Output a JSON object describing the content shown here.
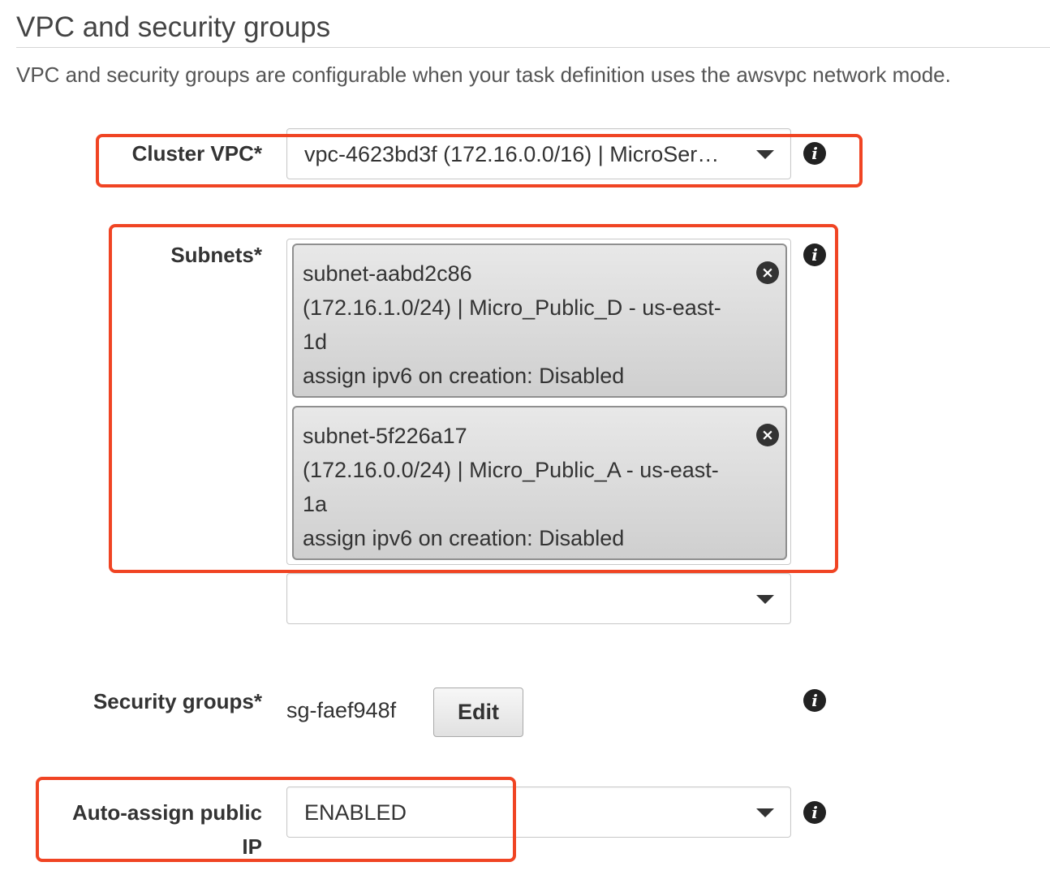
{
  "section": {
    "title": "VPC and security groups",
    "description": "VPC and security groups are configurable when your task definition uses the awsvpc network mode."
  },
  "cluster_vpc": {
    "label": "Cluster VPC*",
    "selected": "vpc-4623bd3f (172.16.0.0/16) | MicroSer…"
  },
  "subnets": {
    "label": "Subnets*",
    "items": [
      {
        "lines": [
          "subnet-aabd2c86",
          "(172.16.1.0/24) | Micro_Public_D - us-east-",
          "1d",
          "assign ipv6 on creation: Disabled"
        ]
      },
      {
        "lines": [
          "subnet-5f226a17",
          "(172.16.0.0/24) | Micro_Public_A - us-east-",
          "1a",
          "assign ipv6 on creation: Disabled"
        ]
      }
    ],
    "add_selected": ""
  },
  "security_groups": {
    "label": "Security groups*",
    "value": "sg-faef948f",
    "edit_label": "Edit"
  },
  "public_ip": {
    "label_line1": "Auto-assign public",
    "label_line2": "IP",
    "selected": "ENABLED"
  },
  "icons": {
    "info": "info-icon",
    "info_glyph": "i",
    "remove": "remove-icon",
    "remove_glyph": "×",
    "dropdown": "chevron-down-icon"
  },
  "colors": {
    "highlight": "#f04423",
    "chip_border": "#8f8f8f"
  }
}
